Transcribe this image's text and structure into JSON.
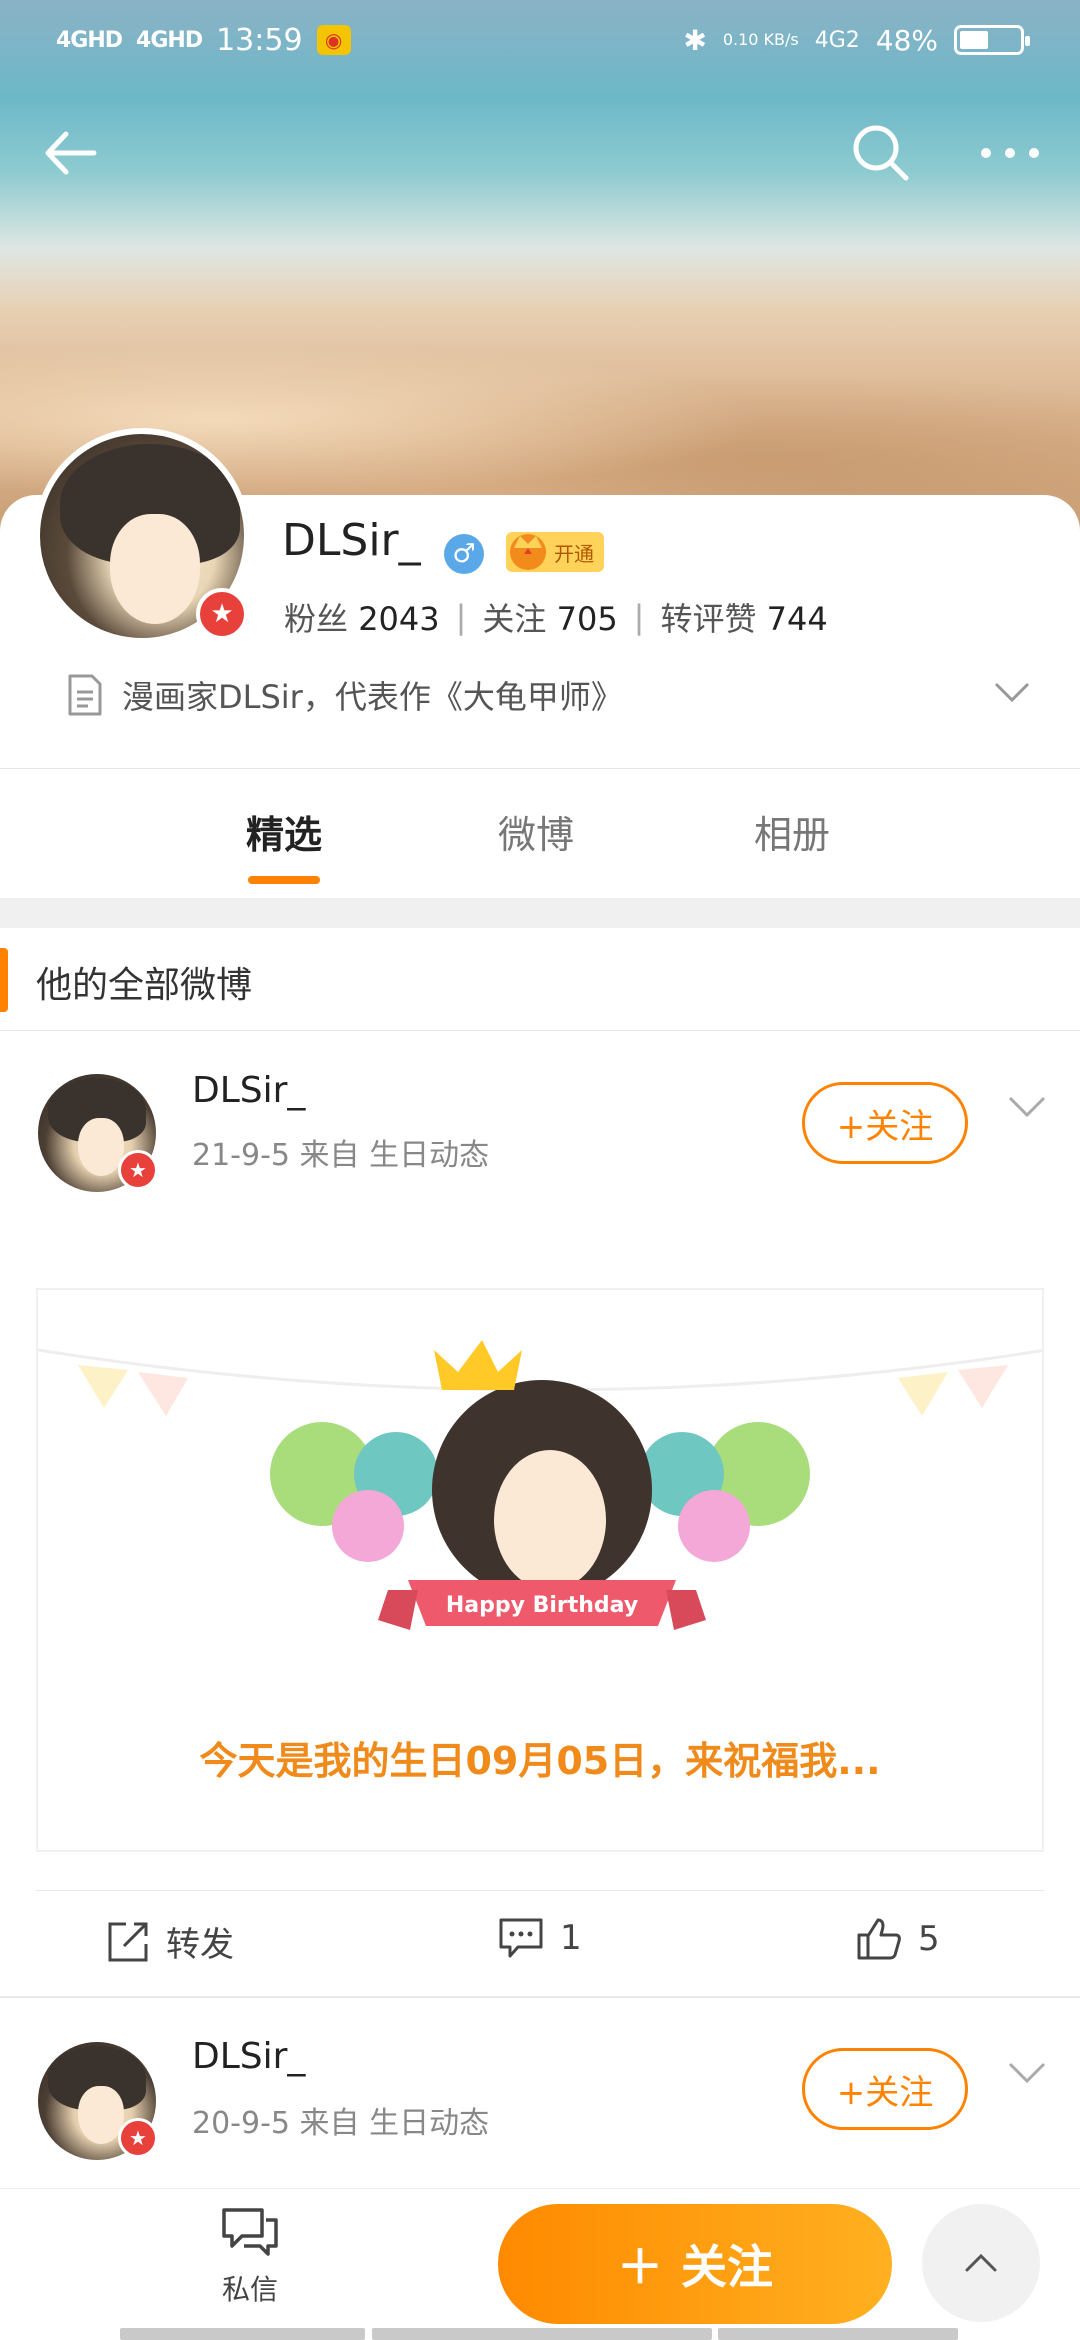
{
  "status_bar": {
    "signal1": "4GHD",
    "signal2": "4GHD",
    "time": "13:59",
    "net_speed": "0.10 KB/s",
    "network": "4G2",
    "battery_pct": "48%",
    "battery_level": 0.48
  },
  "profile": {
    "username": "DLSir_",
    "vip_label": "开通",
    "stats": {
      "fans_label": "粉丝",
      "fans_value": "2043",
      "follow_label": "关注",
      "follow_value": "705",
      "likes_label": "转评赞",
      "likes_value": "744"
    },
    "bio": "漫画家DLSir，代表作《大龟甲师》"
  },
  "tabs": [
    "精选",
    "微博",
    "相册"
  ],
  "active_tab": 0,
  "section_title": "他的全部微博",
  "posts": [
    {
      "author": "DLSir_",
      "meta": "21-9-5  来自 生日动态",
      "follow_label": "+关注",
      "card_banner": "Happy Birthday",
      "card_text": "今天是我的生日09月05日，来祝福我...",
      "repost_label": "转发",
      "comment_count": "1",
      "like_count": "5"
    },
    {
      "author": "DLSir_",
      "meta": "20-9-5  来自 生日动态",
      "follow_label": "+关注"
    }
  ],
  "bottom": {
    "dm_label": "私信",
    "follow_label": "关注"
  },
  "colors": {
    "accent": "#ff8200",
    "badge_red": "#e8413b"
  }
}
